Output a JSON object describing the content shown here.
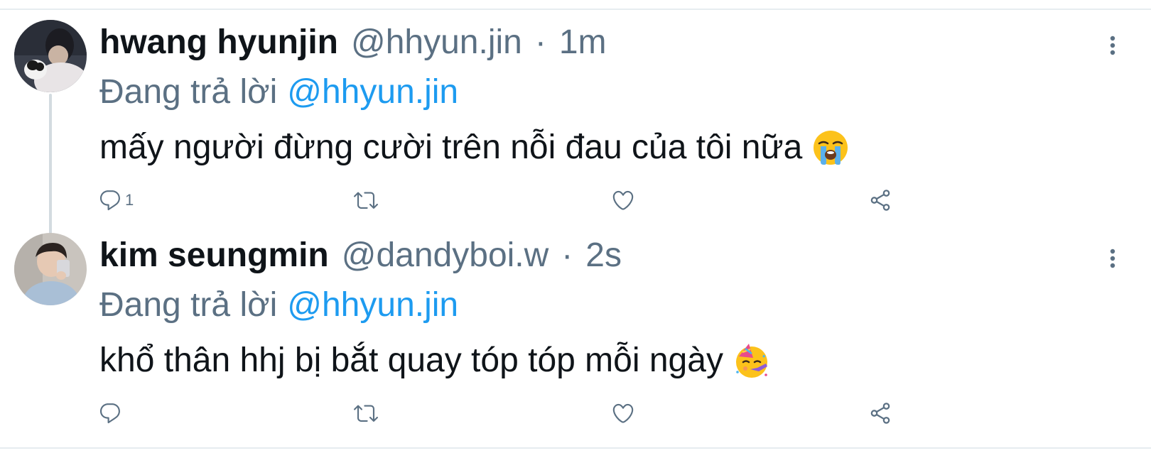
{
  "tweets": [
    {
      "name": "hwang hyunjin",
      "handle": "@hhyun.jin",
      "separator": "·",
      "time": "1m",
      "replying_to_prefix": "Đang trả lời",
      "replying_to_handle": "@hhyun.jin",
      "text": "mấy người đừng cười trên nỗi đau của tôi nữa",
      "emoji": "loudly-crying-face",
      "reply_count": "1"
    },
    {
      "name": "kim seungmin",
      "handle": "@dandyboi.w",
      "separator": "·",
      "time": "2s",
      "replying_to_prefix": "Đang trả lời",
      "replying_to_handle": "@hhyun.jin",
      "text": "khổ thân hhj bị bắt quay tóp tóp mỗi ngày",
      "emoji": "partying-face",
      "reply_count": ""
    }
  ],
  "colors": {
    "text": "#0f1419",
    "secondary": "#5b7083",
    "link": "#1d9bf0",
    "divider": "#e6ecf0",
    "thread_line": "#d3dbe0"
  }
}
